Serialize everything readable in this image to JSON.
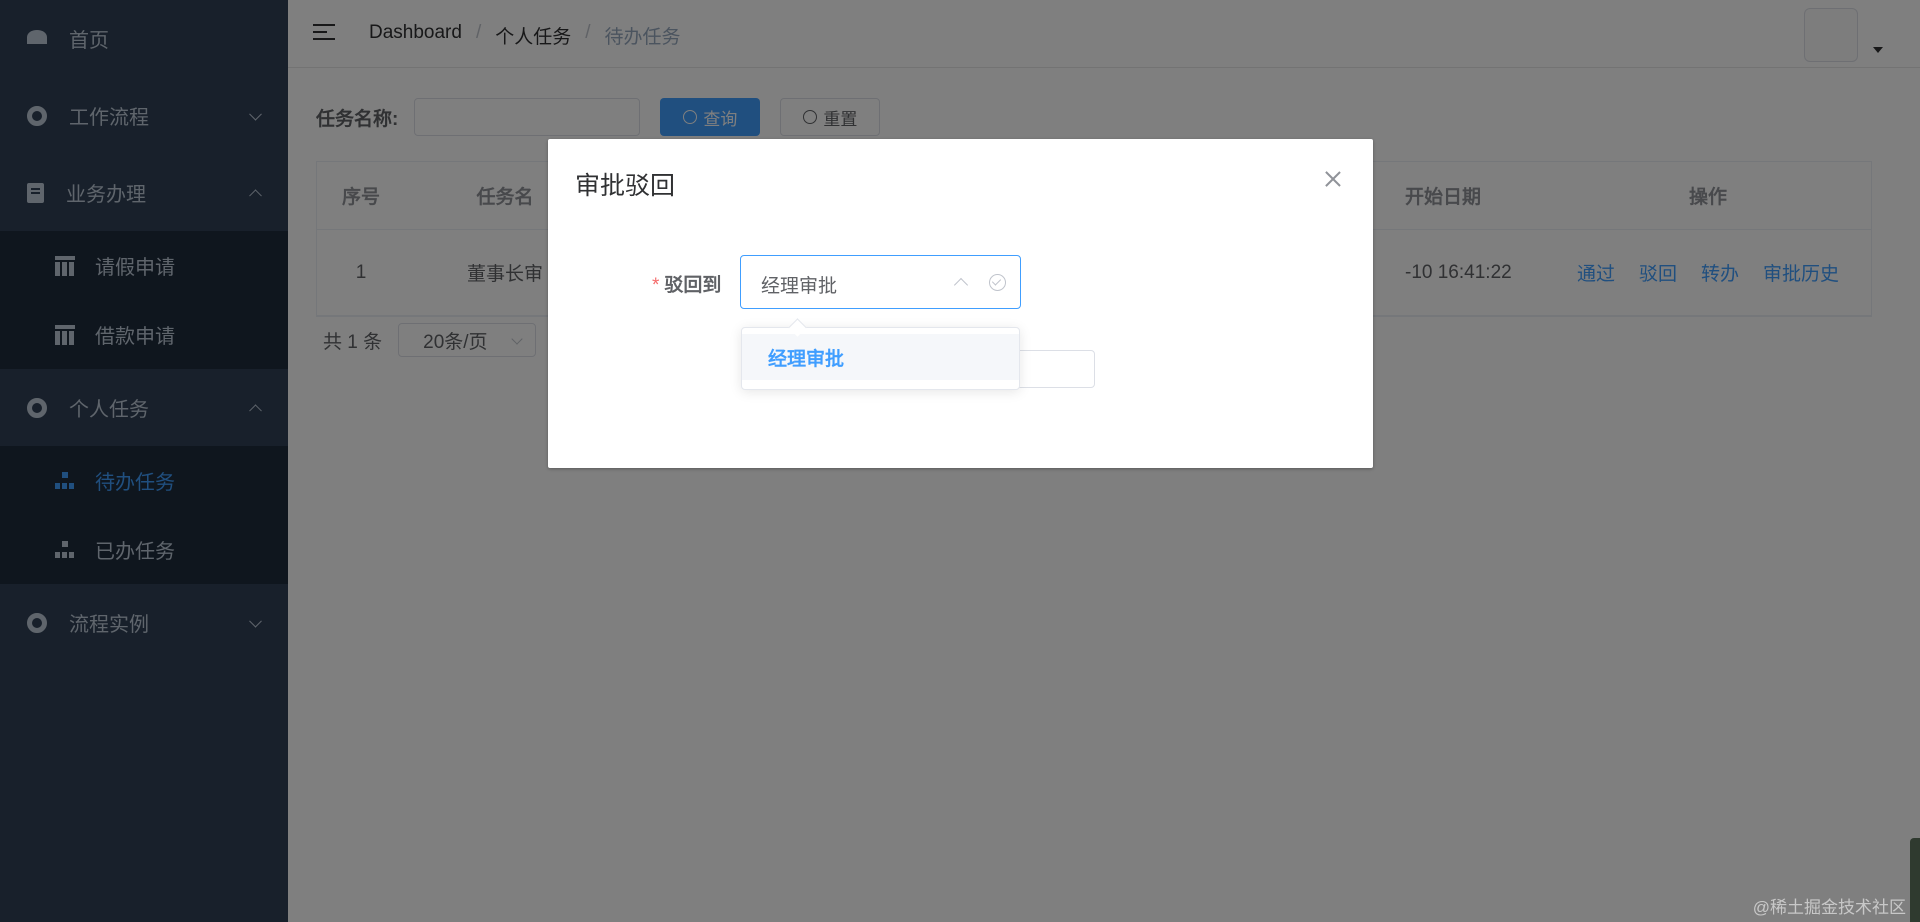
{
  "sidebar": {
    "items": [
      {
        "label": "首页",
        "icon": "dashboard-icon"
      },
      {
        "label": "工作流程",
        "icon": "circle-icon"
      },
      {
        "label": "业务办理",
        "icon": "document-icon"
      },
      {
        "label": "个人任务",
        "icon": "circle-icon"
      },
      {
        "label": "流程实例",
        "icon": "circle-icon"
      }
    ],
    "business_sub": [
      {
        "label": "请假申请",
        "icon": "table-icon"
      },
      {
        "label": "借款申请",
        "icon": "table-icon"
      }
    ],
    "personal_sub": [
      {
        "label": "待办任务",
        "icon": "tree-icon"
      },
      {
        "label": "已办任务",
        "icon": "tree-icon"
      }
    ]
  },
  "breadcrumb": {
    "items": [
      "Dashboard",
      "个人任务",
      "待办任务"
    ],
    "separator": "/"
  },
  "search": {
    "label": "任务名称:",
    "query_label": "查询",
    "reset_label": "重置"
  },
  "table": {
    "headers": [
      "序号",
      "任务名",
      "开始日期",
      "操作"
    ],
    "rows": [
      {
        "index": "1",
        "task_name": "董事长审",
        "start_date": "-10 16:41:22"
      }
    ],
    "actions": [
      "通过",
      "驳回",
      "转办",
      "审批历史"
    ]
  },
  "pagination": {
    "total": "共 1 条",
    "page_size": "20条/页"
  },
  "dialog": {
    "title": "审批驳回",
    "field_label": "驳回到",
    "required_mark": "*",
    "selected_value": "经理审批",
    "options": [
      "经理审批"
    ]
  },
  "watermark": "@稀土掘金技术社区",
  "colors": {
    "sidebar_bg": "#304156",
    "submenu_bg": "#1f2d3d",
    "primary": "#409eff",
    "danger": "#f56c6c"
  }
}
